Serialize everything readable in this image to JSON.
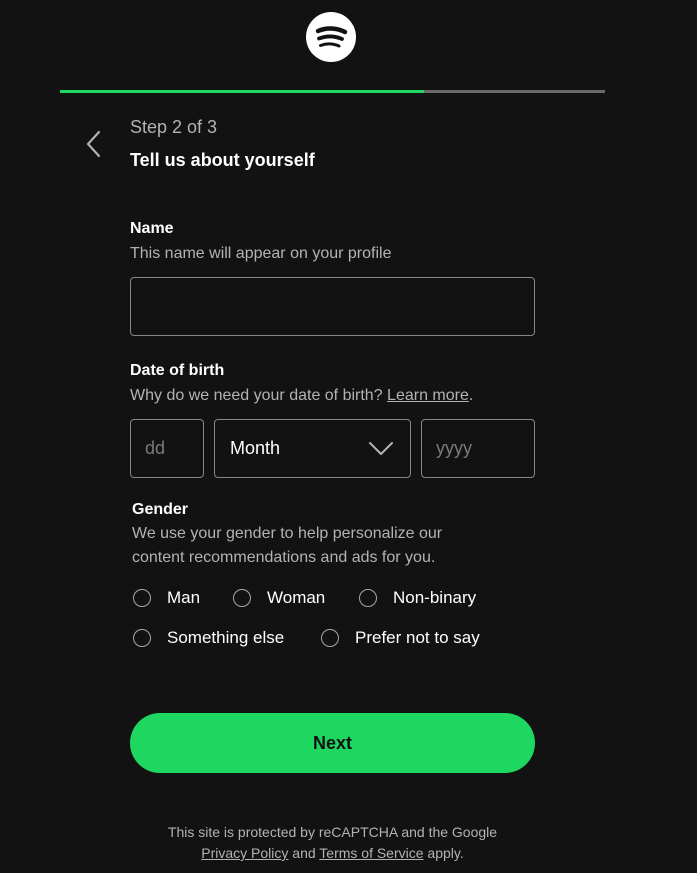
{
  "brand": {
    "logo_icon": "spotify-logo-icon",
    "accent_color": "#1ed760"
  },
  "progress": {
    "current_step": 2,
    "total_steps": 3,
    "fraction_complete": 0.667
  },
  "header": {
    "back_icon": "chevron-left-icon",
    "step_label": "Step 2 of 3",
    "title": "Tell us about yourself"
  },
  "name_field": {
    "label": "Name",
    "help": "This name will appear on your profile",
    "value": "",
    "placeholder": ""
  },
  "dob_field": {
    "label": "Date of birth",
    "help_prefix": "Why do we need your date of birth? ",
    "help_link": "Learn more",
    "help_suffix": ".",
    "day_placeholder": "dd",
    "month_value": "Month",
    "month_icon": "chevron-down-icon",
    "year_placeholder": "yyyy"
  },
  "gender_field": {
    "label": "Gender",
    "help_line1": "We use your gender to help personalize our",
    "help_line2": "content recommendations and ads for you.",
    "options": [
      "Man",
      "Woman",
      "Non-binary",
      "Something else",
      "Prefer not to say"
    ],
    "selected": null
  },
  "next_button": {
    "label": "Next"
  },
  "legal": {
    "line1": "This site is protected by reCAPTCHA and the Google",
    "privacy_link": "Privacy Policy",
    "and_text": " and ",
    "terms_link": "Terms of Service",
    "apply_text": " apply."
  }
}
